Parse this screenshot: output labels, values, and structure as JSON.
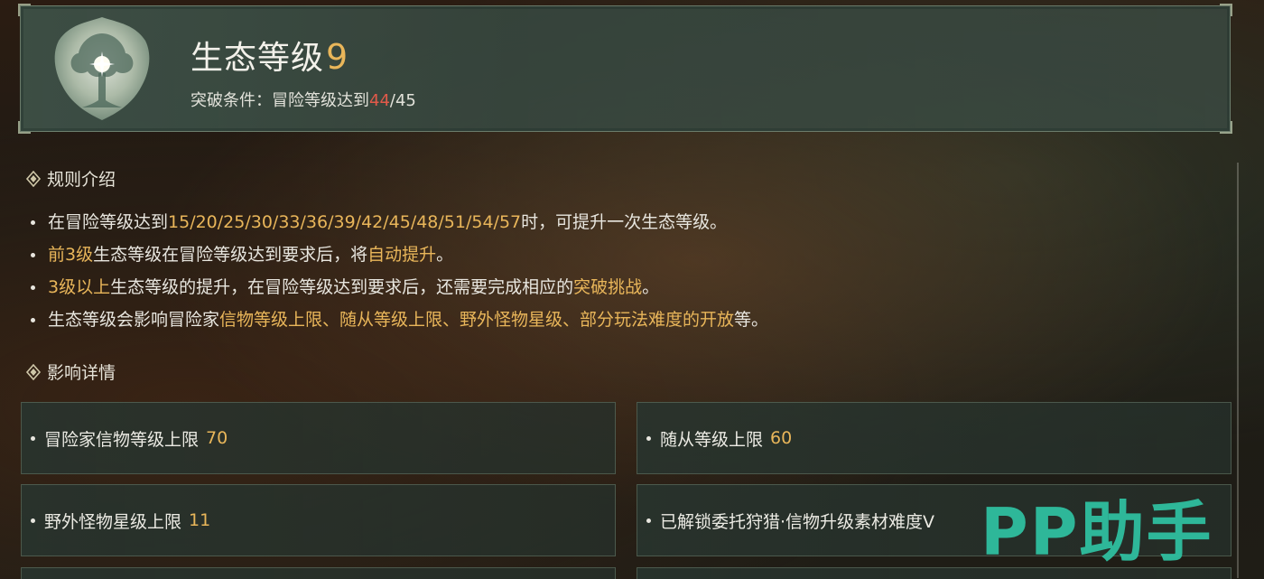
{
  "header": {
    "title": "生态等级",
    "level": "9",
    "condition_label": "突破条件：冒险等级达到",
    "condition_current": "44",
    "condition_target": "/45"
  },
  "sections": {
    "rules_title": "规则介绍",
    "effects_title": "影响详情"
  },
  "rules": [
    {
      "parts": [
        "在冒险等级达到",
        "15/20/25/30/33/36/39/42/45/48/51/54/57",
        "时，可提升一次生态等级。"
      ]
    },
    {
      "parts": [
        "前3级",
        "生态等级在冒险等级达到要求后，将",
        "自动提升",
        "。"
      ]
    },
    {
      "parts": [
        "3级以上",
        "生态等级的提升，在冒险等级达到要求后，还需要完成相应的",
        "突破挑战",
        "。"
      ]
    },
    {
      "parts": [
        "生态等级会影响冒险家",
        "信物等级上限、随从等级上限、野外怪物星级、部分玩法难度的开放",
        "等。"
      ]
    }
  ],
  "effects": [
    {
      "label": "冒险家信物等级上限",
      "value": "70"
    },
    {
      "label": "随从等级上限",
      "value": "60"
    },
    {
      "label": "野外怪物星级上限",
      "value": "11"
    },
    {
      "label": "已解锁委托狩猎·信物升级素材难度V",
      "value": ""
    }
  ],
  "watermark": "PP助手",
  "colors": {
    "highlight": "#e9b65a",
    "alert": "#e25a4a",
    "watermark": "#2fbfa0"
  }
}
